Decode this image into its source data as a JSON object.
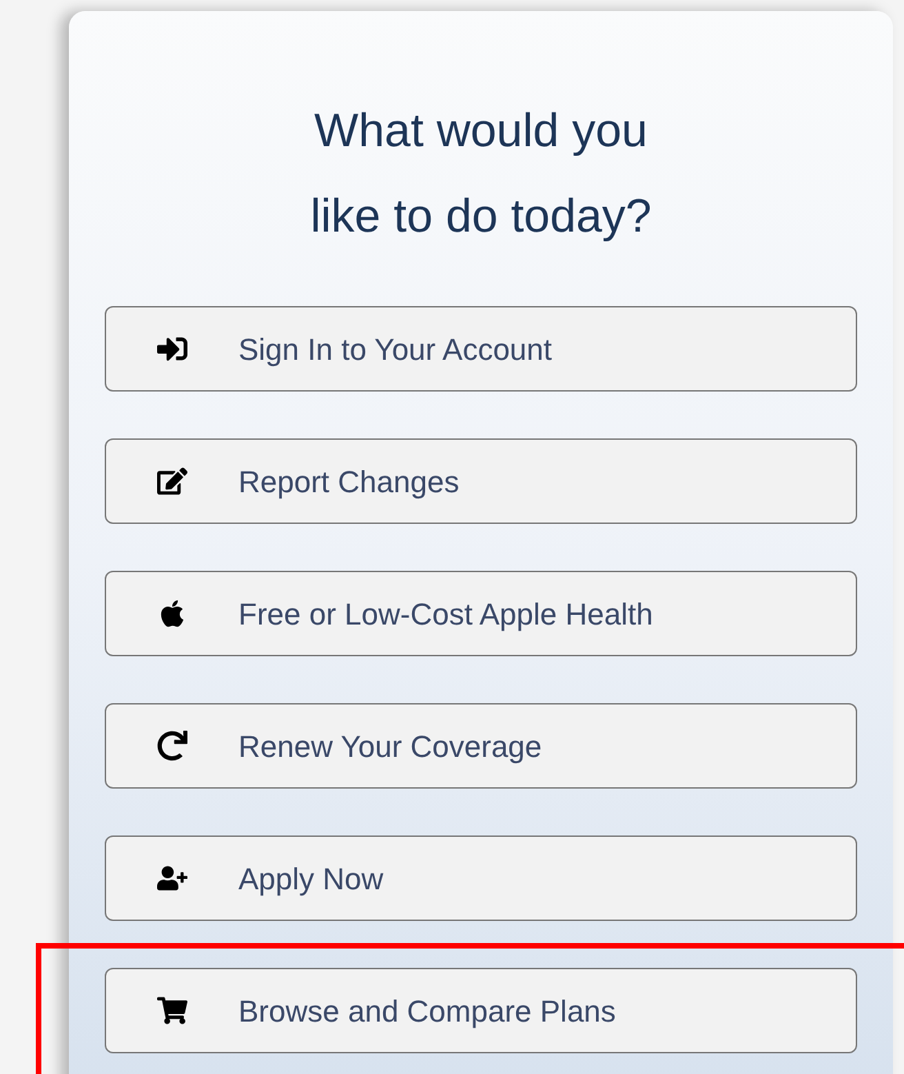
{
  "heading": {
    "lines": [
      "What would you",
      "like to do today?"
    ]
  },
  "actions": [
    {
      "kind": "sign-in",
      "label": "Sign In to Your Account",
      "highlighted": false
    },
    {
      "kind": "edit",
      "label": "Report Changes",
      "highlighted": false
    },
    {
      "kind": "apple",
      "label": "Free or Low-Cost Apple Health",
      "highlighted": false
    },
    {
      "kind": "renew",
      "label": "Renew Your Coverage",
      "highlighted": false
    },
    {
      "kind": "apply",
      "label": "Apply Now",
      "highlighted": false
    },
    {
      "kind": "cart",
      "label": "Browse and Compare Plans",
      "highlighted": true
    }
  ]
}
